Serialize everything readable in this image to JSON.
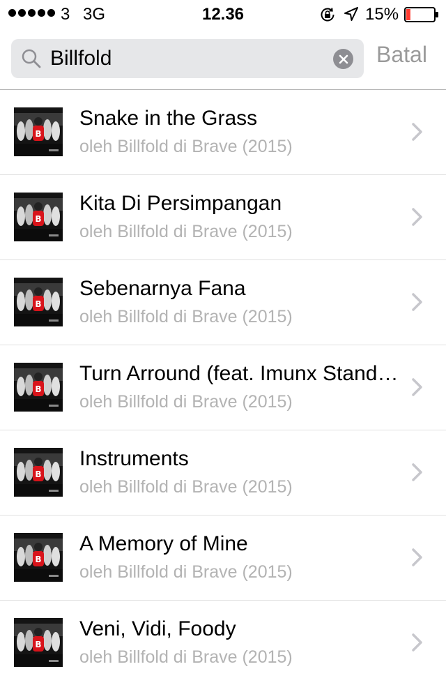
{
  "status_bar": {
    "signal_bars": 5,
    "carrier": "3",
    "network": "3G",
    "time": "12.36",
    "battery_percent": "15%",
    "battery_level": 0.15,
    "battery_color": "#ff3b30"
  },
  "search": {
    "value": "Billfold",
    "placeholder": "",
    "cancel_label": "Batal"
  },
  "results": [
    {
      "title": "Snake in the Grass",
      "subtitle": "oleh Billfold di Brave (2015)"
    },
    {
      "title": "Kita Di Persimpangan",
      "subtitle": "oleh Billfold di Brave (2015)"
    },
    {
      "title": "Sebenarnya Fana",
      "subtitle": "oleh Billfold di Brave (2015)"
    },
    {
      "title": "Turn Arround (feat. Imunx Standup)",
      "subtitle": "oleh Billfold di Brave (2015)"
    },
    {
      "title": "Instruments",
      "subtitle": "oleh Billfold di Brave (2015)"
    },
    {
      "title": "A Memory of Mine",
      "subtitle": "oleh Billfold di Brave (2015)"
    },
    {
      "title": "Veni, Vidi, Foody",
      "subtitle": "oleh Billfold di Brave (2015)"
    }
  ],
  "icons": {
    "search": "search-icon",
    "clear": "clear-icon",
    "chevron": "chevron-right-icon",
    "lock": "rotation-lock-icon",
    "location": "location-arrow-icon",
    "battery": "battery-icon"
  },
  "colors": {
    "search_field_bg": "#e6e7e9",
    "secondary_text": "#b3b3b3",
    "cancel_text": "#9a9a9a"
  }
}
